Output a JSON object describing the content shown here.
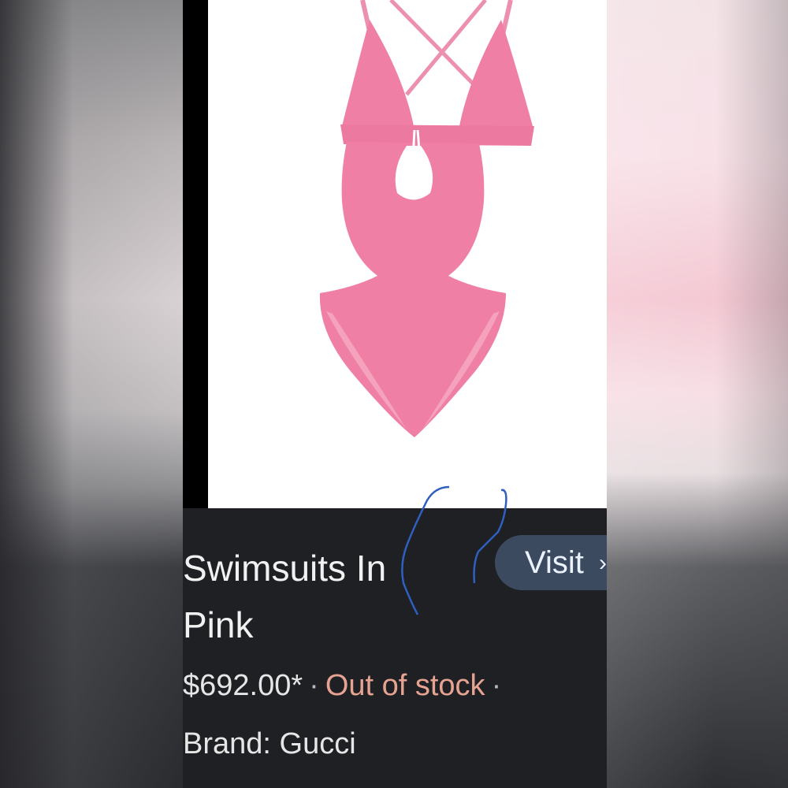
{
  "product": {
    "title": "Swimsuits In Pink",
    "price": "$692.00*",
    "separator": "·",
    "stock_status": "Out of stock",
    "brand": "Brand: Gucci"
  },
  "actions": {
    "visit_label": "Visit",
    "visit_chevron": "›",
    "close_glyph": "×"
  },
  "icons": {
    "close": "close-icon",
    "visit_arrow": "chevron-right-icon"
  },
  "colors": {
    "product_pink": "#f07fa5",
    "stock_status": "#e7a392",
    "visit_button": "#3b4a5e",
    "panel_background": "#1f2024",
    "annotation_ink": "#2f5fbf"
  }
}
